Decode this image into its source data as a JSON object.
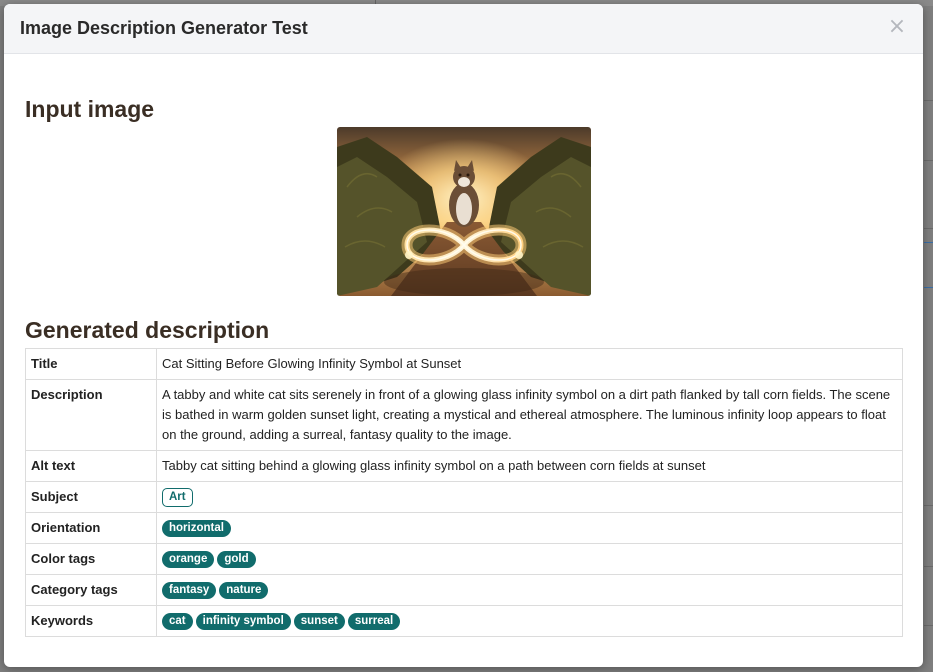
{
  "modal": {
    "title": "Image Description Generator Test",
    "close_label": "×"
  },
  "input_section": {
    "heading": "Input image"
  },
  "description_section": {
    "heading": "Generated description"
  },
  "rows": {
    "title": {
      "label": "Title",
      "value": "Cat Sitting Before Glowing Infinity Symbol at Sunset"
    },
    "description": {
      "label": "Description",
      "value": "A tabby and white cat sits serenely in front of a glowing glass infinity symbol on a dirt path flanked by tall corn fields. The scene is bathed in warm golden sunset light, creating a mystical and ethereal atmosphere. The luminous infinity loop appears to float on the ground, adding a surreal, fantasy quality to the image."
    },
    "alt_text": {
      "label": "Alt text",
      "value": "Tabby cat sitting behind a glowing glass infinity symbol on a path between corn fields at sunset"
    },
    "subject": {
      "label": "Subject",
      "tags": [
        "Art"
      ]
    },
    "orientation": {
      "label": "Orientation",
      "tags": [
        "horizontal"
      ]
    },
    "color_tags": {
      "label": "Color tags",
      "tags": [
        "orange",
        "gold"
      ]
    },
    "category_tags": {
      "label": "Category tags",
      "tags": [
        "fantasy",
        "nature"
      ]
    },
    "keywords": {
      "label": "Keywords",
      "tags": [
        "cat",
        "infinity symbol",
        "sunset",
        "surreal"
      ]
    }
  },
  "colors": {
    "tag_bg": "#116c6c",
    "header_bg": "#f4f5f7",
    "heading_text": "#3a2e24"
  }
}
